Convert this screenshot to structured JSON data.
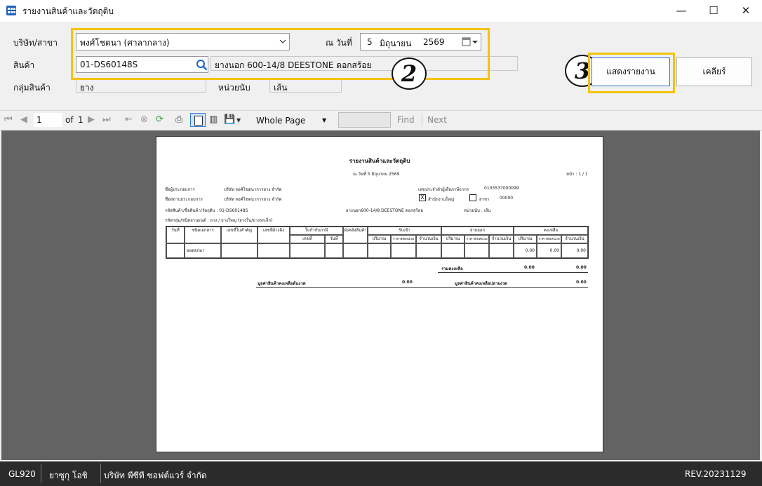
{
  "window": {
    "title": "รายงานสินค้าและวัตถุดิบ",
    "minimize": "—",
    "maximize": "☐",
    "close": "✕"
  },
  "form": {
    "branch_label": "บริษัท/สาขา",
    "branch_value": "พงศ์โชตนา (ศาลากลาง)",
    "date_label": "ณ วันที่",
    "date_day": "5",
    "date_month": "มิถุนายน",
    "date_year": "2569",
    "product_label": "สินค้า",
    "product_code": "01-DS60148S",
    "product_name": "ยางนอก 600-14/8 DEESTONE  ดอกสร้อย",
    "group_label": "กลุ่มสินค้า",
    "group_value": "ยาง",
    "unit_label": "หน่วยนับ",
    "unit_value": "เส้น",
    "show_button": "แสดงรายงาน",
    "clear_button": "เคลียร์",
    "callout_2": "2",
    "callout_3": "3"
  },
  "toolbar": {
    "page_current": "1",
    "of_label": "of",
    "page_total": "1",
    "zoom_option": "Whole Page",
    "find_label": "Find",
    "next_label": "Next"
  },
  "report": {
    "title": "รายงานสินค้าและวัตถุดิบ",
    "date_line": "ณ วันที่  5 มิถุนายน 2569",
    "page_label": "หน้า : 1 / 1",
    "operator_label": "ชื่อผู้ประกอบการ",
    "operator_value": "บริษัท พงศ์โชตนาการยาง จำกัด",
    "place_label": "ชื่อสถานประกอบการ",
    "place_value": "บริษัท พงศ์โชตนาการยาง จำกัด",
    "taxid_label": "เลขประจำตัวผู้เสียภาษีอากร",
    "taxid_value": "0105537000099",
    "head_office": "สำนักงานใหญ่",
    "branch_label": "สาขา",
    "branch_no": "00000",
    "head_checked": "X",
    "product_code_line": "รหัสสินค้า/ชื่อสินค้า/วัตถุดิบ  :  01-DS60148S",
    "product_name": "ยางนอก600-14/8  DEESTONE  ดอกสร้อย",
    "unit_line": "หน่วยนับ  :  เส้น",
    "group_line": "รหัสกลุ่ม/ชนิดยานยนต์        :  ยาง / ยางใหญ่ (ยางใน/ยางรถเล็ก)",
    "col_date": "วันที่",
    "col_doctype": "ชนิดเอกสาร",
    "col_docno": "เลขที่ใบสำคัญ",
    "col_ref": "เลขที่อ้างอิง",
    "col_taxinv": "ใบกำกับภาษี",
    "col_taxinv_no": "เลขที่",
    "col_taxinv_date": "วันที่",
    "col_warehouse": "ผังคลังสินค้า",
    "col_in": "รับเข้า",
    "col_out": "จ่ายออก",
    "col_bal": "คงเหลือ",
    "col_qty": "ปริมาณ",
    "col_unitprice": "ราคาต่อหน่วย",
    "col_amount": "จำนวนเงิน",
    "row_doc": "ยอดยกมา",
    "row_qty": "0.00",
    "row_price": "0.00",
    "row_amount": "0.00",
    "total_label": "รวมคงเหลือ",
    "total_qty": "0.00",
    "total_amount": "0.00",
    "value_begin_label": "มูลค่าสินค้าคงเหลือต้นงวด",
    "value_begin": "0.00",
    "value_end_label": "มูลค่าสินค้าคงเหลือปลายงวด",
    "value_end": "0.00"
  },
  "status": {
    "code": "GL920",
    "user": "ยาซูกุ  โอชิ",
    "company": "บริษัท พีซีที ซอฟต์แวร์ จำกัด",
    "revision": "REV.20231129"
  }
}
